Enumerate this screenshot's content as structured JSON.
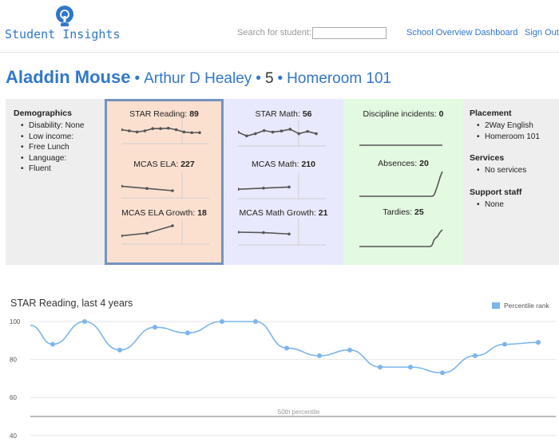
{
  "header": {
    "logo_text": "Student Insights",
    "search_label": "Search for student:",
    "search_value": "",
    "nav_links": [
      "School Overview Dashboard",
      "Sign Out"
    ]
  },
  "title": {
    "student_name": "Aladdin Mouse",
    "school": "Arthur D Healey",
    "grade": "5",
    "homeroom": "Homeroom 101"
  },
  "demographics": {
    "heading": "Demographics",
    "items": [
      "Disability: None",
      "Low income:",
      "Free Lunch",
      "Language:",
      "Fluent"
    ]
  },
  "reading": {
    "star_label": "STAR Reading:",
    "star_value": "89",
    "ela_label": "MCAS ELA:",
    "ela_value": "227",
    "ela_growth_label": "MCAS ELA Growth:",
    "ela_growth_value": "18",
    "star_spark": [
      0.55,
      0.5,
      0.45,
      0.5,
      0.6,
      0.6,
      0.62,
      0.55,
      0.45,
      0.42,
      0.42
    ],
    "ela_spark": [
      0.45,
      0.35,
      0.25
    ],
    "ela_growth_spark": [
      0.3,
      0.42,
      0.75
    ]
  },
  "math": {
    "star_label": "STAR Math:",
    "star_value": "56",
    "mcas_label": "MCAS Math:",
    "mcas_value": "210",
    "growth_label": "MCAS Math Growth:",
    "growth_value": "21",
    "star_spark": [
      0.55,
      0.38,
      0.48,
      0.62,
      0.55,
      0.6,
      0.68,
      0.48,
      0.58,
      0.48
    ],
    "mcas_spark": [
      0.35,
      0.4,
      0.45
    ],
    "growth_spark": [
      0.5,
      0.48,
      0.42
    ]
  },
  "discipline": {
    "incidents_label": "Discipline incidents:",
    "incidents_value": "0",
    "absences_label": "Absences:",
    "absences_value": "20",
    "tardies_label": "Tardies:",
    "tardies_value": "25"
  },
  "placement": {
    "heading": "Placement",
    "items": [
      "2Way English",
      "Homeroom 101"
    ],
    "services_heading": "Services",
    "services_items": [
      "No services"
    ],
    "staff_heading": "Support staff",
    "staff_items": [
      "None"
    ]
  },
  "colors": {
    "accent": "#3177c9",
    "reading_bg": "#fbe0d0",
    "math_bg": "#e9e9fd",
    "discipline_bg": "#e3f9e1",
    "series": "#7cb5ec"
  },
  "chart_data": {
    "type": "line",
    "title": "STAR Reading, last 4 years",
    "series": [
      {
        "name": "Percentile rank",
        "x": [
          0,
          1,
          2,
          3,
          4,
          5,
          6,
          7,
          8,
          9,
          10,
          11,
          12,
          13,
          14,
          15
        ],
        "values": [
          88,
          100,
          85,
          97,
          94,
          100,
          100,
          86,
          82,
          85,
          76,
          76,
          73,
          82,
          88,
          89
        ]
      }
    ],
    "start_value": 98,
    "yticks": [
      100,
      80,
      60,
      40
    ],
    "ylim": [
      40,
      100
    ],
    "reference_line": {
      "value": 50,
      "label": "50th percentile"
    },
    "legend": "top-right",
    "grid": true
  }
}
